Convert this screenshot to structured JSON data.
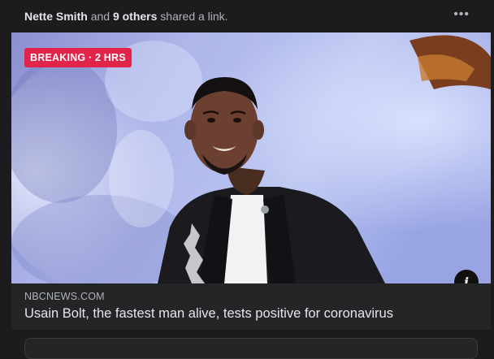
{
  "post": {
    "sharer_name": "Nette Smith",
    "connector": "and",
    "others": "9 others",
    "action": "shared a link.",
    "more_icon": "•••"
  },
  "link": {
    "badge": "BREAKING · 2 HRS",
    "badge_color": "#e0244a",
    "info_icon": "i",
    "domain": "NBCNEWS.COM",
    "headline": "Usain Bolt, the fastest man alive, tests positive for coronavirus"
  }
}
